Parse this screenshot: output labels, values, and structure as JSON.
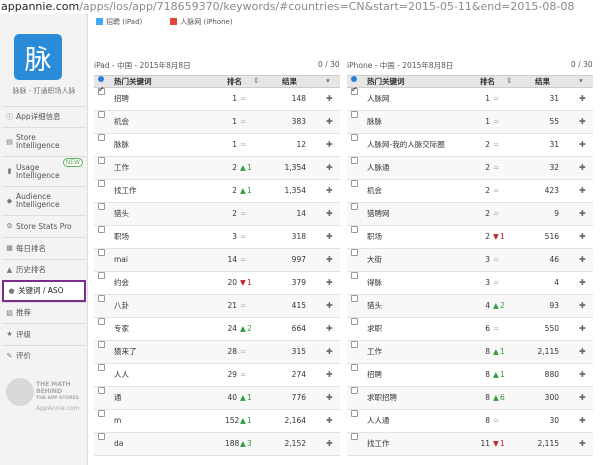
{
  "url": {
    "host": "appannie.com",
    "path": "/apps/ios/app/718659370/keywords/#countries=CN&start=2015-05-11&end=2015-08-08"
  },
  "sidebar": {
    "logo_char": "脉",
    "logo_caption": "脉脉 - 打通职场人脉",
    "items": [
      {
        "label": "App详细信息",
        "icon": "info-icon"
      },
      {
        "label": "Store Intelligence",
        "icon": "store-icon"
      },
      {
        "label": "Usage Intelligence",
        "icon": "usage-icon",
        "badge": "NEW"
      },
      {
        "label": "Audience Intelligence",
        "icon": "audience-icon"
      },
      {
        "label": "Store Stats Pro",
        "icon": "gear-icon"
      },
      {
        "label": "每日排名",
        "icon": "calendar-icon"
      },
      {
        "label": "历史排名",
        "icon": "history-icon"
      },
      {
        "label": "关键词 / ASO",
        "icon": "location-pin-icon"
      },
      {
        "label": "推荐",
        "icon": "featured-icon"
      },
      {
        "label": "评级",
        "icon": "star-icon"
      },
      {
        "label": "评价",
        "icon": "comment-icon"
      }
    ],
    "promo": {
      "line1": "THE MATH",
      "line2": "BEHIND",
      "line3": "THE APP STORES",
      "site": "AppAnnie.com"
    }
  },
  "legend": [
    {
      "label": "招聘 (iPad)",
      "color": "#3fa9f5"
    },
    {
      "label": "人脉网 (iPhone)",
      "color": "#e0443a"
    }
  ],
  "colors": {
    "accent": "#2a8cd8",
    "active_border": "#7b2d8e",
    "up": "#2e9c3c",
    "down": "#c0262c"
  },
  "panels": [
    {
      "title": "iPad - 中国 - 2015年8月8日",
      "count": "0 / 30",
      "headers": {
        "keyword": "热门关键词",
        "rank": "排名",
        "results": "结果"
      },
      "rows": [
        {
          "kw": "招聘",
          "rank": "1",
          "dir": "=",
          "chg": "",
          "res": "148",
          "checked": true
        },
        {
          "kw": "机会",
          "rank": "1",
          "dir": "=",
          "chg": "",
          "res": "383",
          "checked": false
        },
        {
          "kw": "脉脉",
          "rank": "1",
          "dir": "=",
          "chg": "",
          "res": "12",
          "checked": false
        },
        {
          "kw": "工作",
          "rank": "2",
          "dir": "▲",
          "chg": "1",
          "res": "1,354",
          "checked": false
        },
        {
          "kw": "找工作",
          "rank": "2",
          "dir": "▲",
          "chg": "1",
          "res": "1,354",
          "checked": false
        },
        {
          "kw": "猎头",
          "rank": "2",
          "dir": "=",
          "chg": "",
          "res": "14",
          "checked": false
        },
        {
          "kw": "职场",
          "rank": "3",
          "dir": "=",
          "chg": "",
          "res": "318",
          "checked": false
        },
        {
          "kw": "mai",
          "rank": "14",
          "dir": "=",
          "chg": "",
          "res": "997",
          "checked": false
        },
        {
          "kw": "约会",
          "rank": "20",
          "dir": "▼",
          "chg": "1",
          "res": "379",
          "checked": false
        },
        {
          "kw": "八卦",
          "rank": "21",
          "dir": "=",
          "chg": "",
          "res": "415",
          "checked": false
        },
        {
          "kw": "专家",
          "rank": "24",
          "dir": "▲",
          "chg": "2",
          "res": "664",
          "checked": false
        },
        {
          "kw": "猿来了",
          "rank": "28",
          "dir": "=",
          "chg": "",
          "res": "315",
          "checked": false
        },
        {
          "kw": "人人",
          "rank": "29",
          "dir": "=",
          "chg": "",
          "res": "274",
          "checked": false
        },
        {
          "kw": "通",
          "rank": "40",
          "dir": "▲",
          "chg": "1",
          "res": "776",
          "checked": false
        },
        {
          "kw": "m",
          "rank": "152",
          "dir": "▲",
          "chg": "1",
          "res": "2,164",
          "checked": false
        },
        {
          "kw": "da",
          "rank": "188",
          "dir": "▲",
          "chg": "3",
          "res": "2,152",
          "checked": false
        }
      ]
    },
    {
      "title": "iPhone - 中国 - 2015年8月8日",
      "count": "0 / 30",
      "headers": {
        "keyword": "热门关键词",
        "rank": "排名",
        "results": "结果"
      },
      "rows": [
        {
          "kw": "人脉网",
          "rank": "1",
          "dir": "=",
          "chg": "",
          "res": "31",
          "checked": true
        },
        {
          "kw": "脉脉",
          "rank": "1",
          "dir": "=",
          "chg": "",
          "res": "55",
          "checked": false
        },
        {
          "kw": "人脉网-我的人脉交际圈",
          "rank": "2",
          "dir": "=",
          "chg": "",
          "res": "31",
          "checked": false
        },
        {
          "kw": "人脉通",
          "rank": "2",
          "dir": "=",
          "chg": "",
          "res": "32",
          "checked": false
        },
        {
          "kw": "机会",
          "rank": "2",
          "dir": "=",
          "chg": "",
          "res": "423",
          "checked": false
        },
        {
          "kw": "猎聘网",
          "rank": "2",
          "dir": "=",
          "chg": "",
          "res": "9",
          "checked": false
        },
        {
          "kw": "职场",
          "rank": "2",
          "dir": "▼",
          "chg": "1",
          "res": "516",
          "checked": false
        },
        {
          "kw": "大街",
          "rank": "3",
          "dir": "=",
          "chg": "",
          "res": "46",
          "checked": false
        },
        {
          "kw": "得脉",
          "rank": "3",
          "dir": "=",
          "chg": "",
          "res": "4",
          "checked": false
        },
        {
          "kw": "猎头",
          "rank": "4",
          "dir": "▲",
          "chg": "2",
          "res": "93",
          "checked": false
        },
        {
          "kw": "求职",
          "rank": "6",
          "dir": "=",
          "chg": "",
          "res": "550",
          "checked": false
        },
        {
          "kw": "工作",
          "rank": "8",
          "dir": "▲",
          "chg": "1",
          "res": "2,115",
          "checked": false
        },
        {
          "kw": "招聘",
          "rank": "8",
          "dir": "▲",
          "chg": "1",
          "res": "880",
          "checked": false
        },
        {
          "kw": "求职招聘",
          "rank": "8",
          "dir": "▲",
          "chg": "6",
          "res": "300",
          "checked": false
        },
        {
          "kw": "人人通",
          "rank": "8",
          "dir": "=",
          "chg": "",
          "res": "30",
          "checked": false
        },
        {
          "kw": "找工作",
          "rank": "11",
          "dir": "▼",
          "chg": "1",
          "res": "2,115",
          "checked": false
        }
      ]
    }
  ]
}
